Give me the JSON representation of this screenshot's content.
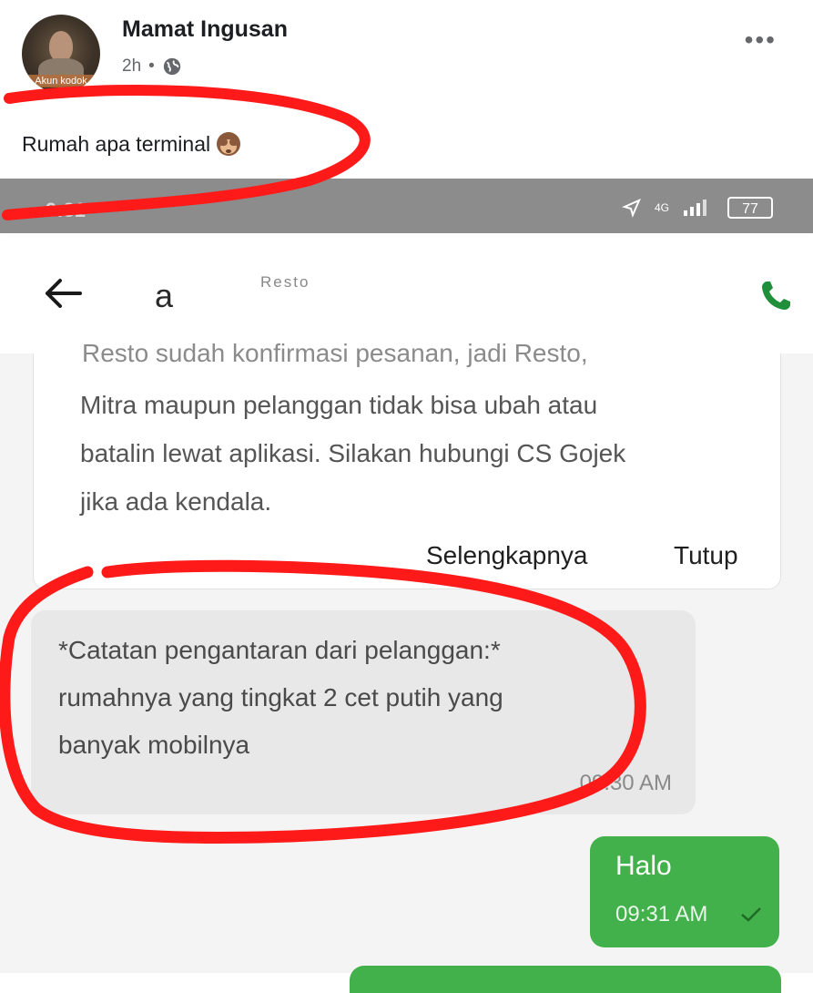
{
  "post": {
    "author": "Mamat Ingusan",
    "time": "2h",
    "avatar_badge": "Akun kodok",
    "text": "Rumah apa terminal",
    "more_icon": "more-dots-icon",
    "privacy_icon": "globe-icon",
    "emoji_icon": "see-no-evil-monkey-icon"
  },
  "phone_status": {
    "time": "9:31",
    "network": "4G",
    "battery": "77"
  },
  "chat": {
    "title": "a",
    "subtitle": "Resto",
    "back_icon": "back-arrow-icon",
    "call_icon": "phone-icon",
    "info_card": {
      "cut_line": "Resto sudah konfirmasi pesanan, jadi Resto,",
      "lines": [
        "Mitra maupun pelanggan tidak bisa ubah atau",
        "batalin lewat aplikasi. Silakan hubungi CS Gojek",
        "jika ada kendala."
      ],
      "more_label": "Selengkapnya",
      "close_label": "Tutup"
    },
    "note": {
      "lines": [
        "*Catatan pengantaran dari pelanggan:*",
        "rumahnya yang tingkat 2 cet putih yang",
        "banyak mobilnya"
      ],
      "time": "09:30 AM"
    },
    "sent": {
      "text": "Halo",
      "time": "09:31 AM"
    }
  },
  "colors": {
    "sent_bubble": "#43b14b",
    "call_icon": "#1f8f3a",
    "highlight_marker": "#ff1a1a",
    "status_bar": "#8c8c8c"
  }
}
